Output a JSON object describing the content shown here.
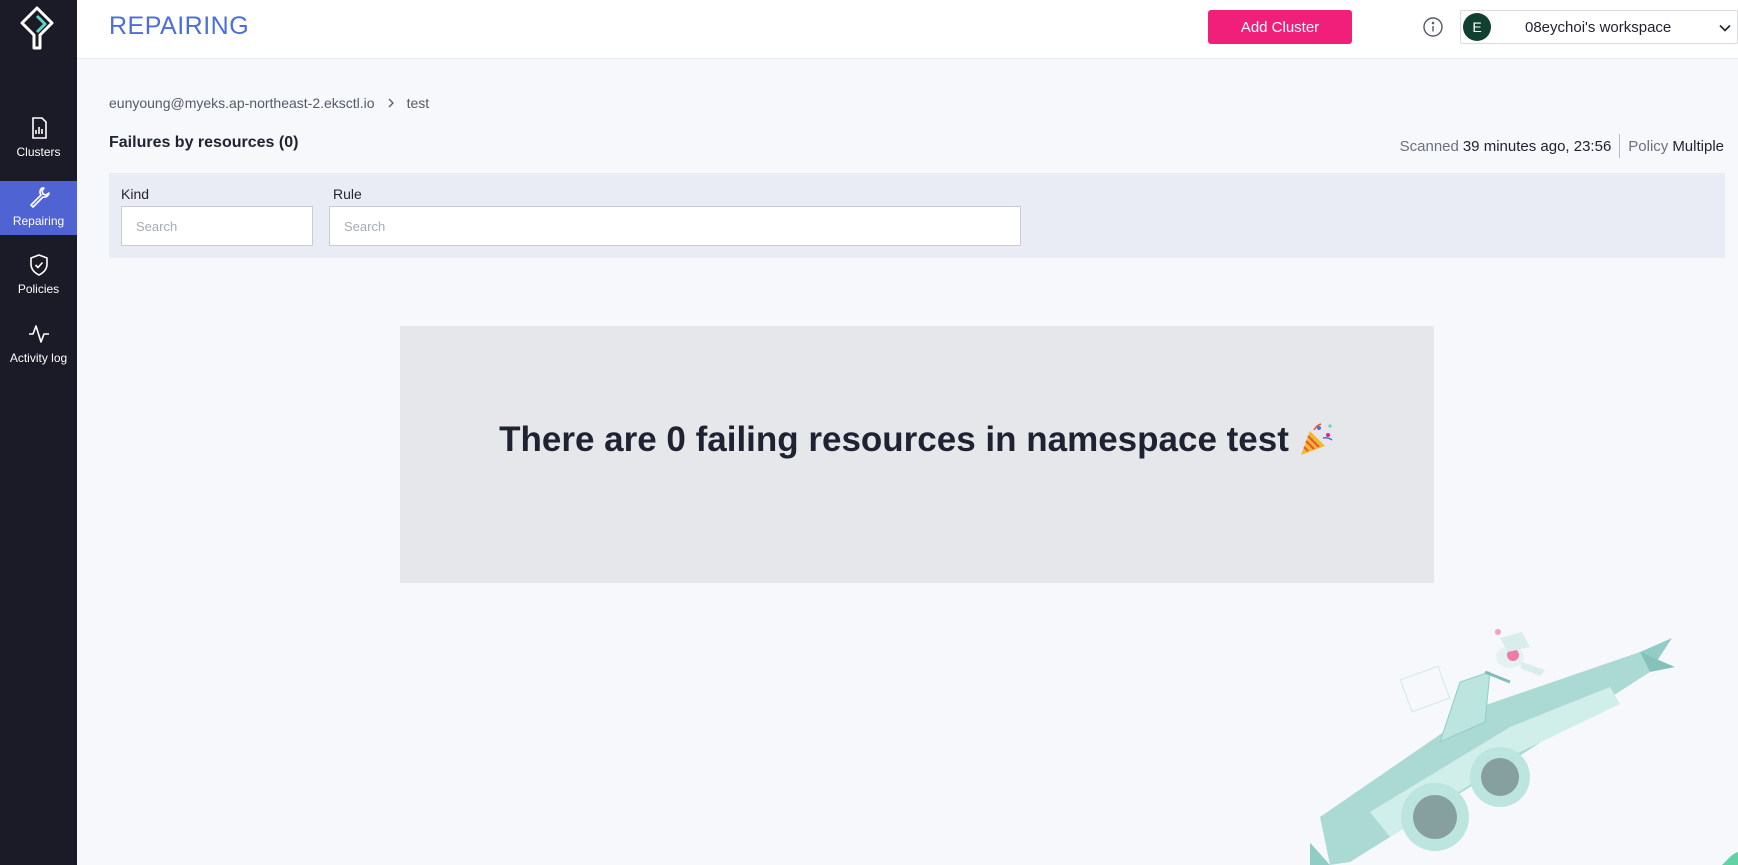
{
  "sidebar": {
    "items": [
      {
        "label": "Clusters",
        "icon": "bar-chart-icon"
      },
      {
        "label": "Repairing",
        "icon": "wrench-icon",
        "active": true
      },
      {
        "label": "Policies",
        "icon": "shield-check-icon"
      },
      {
        "label": "Activity log",
        "icon": "activity-pulse-icon"
      }
    ]
  },
  "header": {
    "title": "REPAIRING",
    "add_cluster_label": "Add Cluster",
    "workspace": {
      "avatar_initial": "E",
      "name": "08eychoi's workspace"
    }
  },
  "breadcrumb": {
    "cluster": "eunyoung@myeks.ap-northeast-2.eksctl.io",
    "namespace": "test"
  },
  "section": {
    "title": "Failures by resources (0)"
  },
  "scan": {
    "scanned_label": "Scanned",
    "scanned_value": "39 minutes ago, 23:56",
    "policy_label": "Policy",
    "policy_value": "Multiple"
  },
  "filters": {
    "kind_label": "Kind",
    "kind_placeholder": "Search",
    "rule_label": "Rule",
    "rule_placeholder": "Search"
  },
  "empty_state": {
    "message": "There are 0 failing resources in namespace test",
    "icon": "party-popper-icon"
  },
  "colors": {
    "sidebar_bg": "#1b1a27",
    "active_nav": "#4f63d2",
    "title_blue": "#4b6fd8",
    "accent_pink": "#f0207a",
    "avatar_green": "#10402f"
  }
}
